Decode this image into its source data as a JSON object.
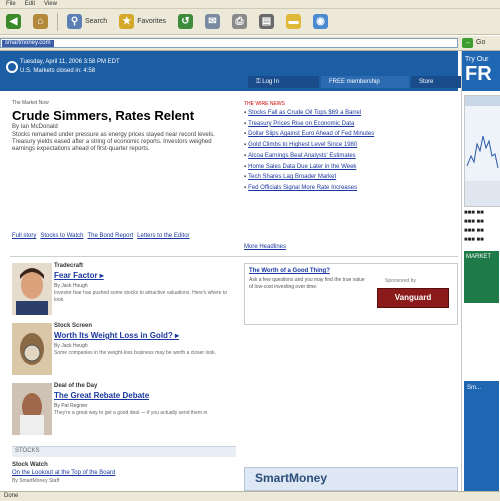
{
  "menubar": {
    "items": [
      "File",
      "Edit",
      "View"
    ]
  },
  "toolbar": {
    "search_label": "Search",
    "favorites_label": "Favorites"
  },
  "addressbar": {
    "url": "smartmoney.com",
    "go_label": "Go"
  },
  "header": {
    "date_line": "Tuesday, April 11, 2006 3:58 PM EDT",
    "index_line": "U.S. Markets closed in: 4:58",
    "nav": {
      "login": "Log In",
      "free_membership": "FREE membership",
      "store": "Store"
    }
  },
  "right_strip": {
    "top_line1": "Try Our",
    "top_line2": "FR",
    "market_box": "MARKET",
    "promo_line": "Sm..."
  },
  "lead": {
    "label": "The Market Now",
    "title": "Crude Simmers, Rates Relent",
    "byline": "By Ian McDonald",
    "body": "Stocks remained under pressure as energy prices stayed near record levels. Treasury yields eased after a string of economic reports. Investors weighed earnings expectations ahead of first-quarter reports.",
    "links": [
      "Full story",
      "Stocks to Watch",
      "The Bond Report",
      "Letters to the Editor"
    ]
  },
  "news": {
    "header": "THE WIRE NEWS",
    "items": [
      "Stocks Fall as Crude Oil Tops $69 a Barrel",
      "Treasury Prices Rise on Economic Data",
      "Dollar Slips Against Euro Ahead of Fed Minutes",
      "Gold Climbs to Highest Level Since 1980",
      "Alcoa Earnings Beat Analysts' Estimates",
      "Home Sales Data Due Later in the Week",
      "Tech Shares Lag Broader Market",
      "Fed Officials Signal More Rate Increases"
    ],
    "more": "More Headlines"
  },
  "stories": [
    {
      "category": "Tradecraft",
      "headline": "Fear Factor ▸",
      "byline": "By Jack Hough",
      "desc": "Investor fear has pushed some stocks to attractive valuations. Here's where to look."
    },
    {
      "category": "Stock Screen",
      "headline": "Worth Its Weight Loss in Gold? ▸",
      "byline": "By Jack Hough",
      "desc": "Some companies in the weight-loss business may be worth a closer look."
    },
    {
      "category": "Deal of the Day",
      "headline": "The Great Rebate Debate",
      "byline": "By Pat Regnier",
      "desc": "They're a great way to get a good deal — if you actually send them in."
    }
  ],
  "stocks_bar": "STOCKS",
  "stock_watch": {
    "label": "Stock Watch",
    "headline": "On the Lookout at the Top of the Board",
    "byline": "By SmartMoney Staff"
  },
  "ad": {
    "title": "The Worth of a Good Thing?",
    "body": "Ask a few questions and you may find the true value of low-cost investing over time.",
    "sponsor": "Sponsored by",
    "brand": "Vanguard"
  },
  "smartmoney_banner": "SmartMoney",
  "status": "Done"
}
